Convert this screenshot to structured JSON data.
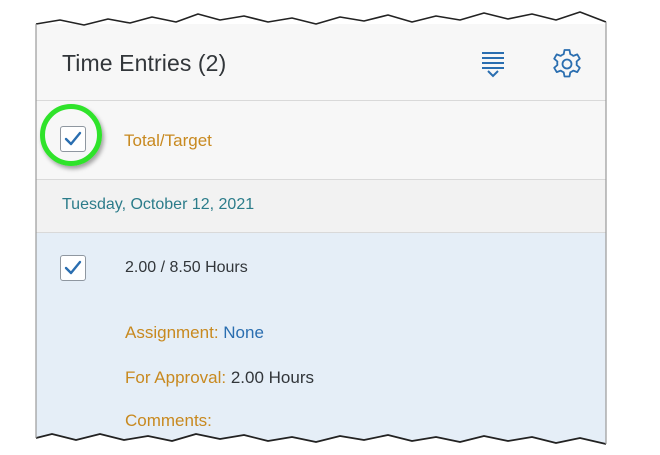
{
  "header": {
    "title": "Time Entries (2)"
  },
  "icons": {
    "sort": "sort-icon",
    "settings": "gear-icon",
    "checkmark": "checkmark-icon"
  },
  "total_row": {
    "label": "Total/Target",
    "checked": true
  },
  "date_group": {
    "label": "Tuesday, October 12, 2021"
  },
  "entry": {
    "checked": true,
    "hours": "2.00 / 8.50 Hours",
    "assignment_label": "Assignment:",
    "assignment_value": "None",
    "approval_label": "For Approval:",
    "approval_value": "2.00 Hours",
    "comments_label": "Comments:"
  },
  "colors": {
    "accent_label": "#c8891f",
    "link": "#2a6eb0",
    "date_text": "#2b7c8a",
    "selected_bg": "#e5eef7",
    "highlight_ring": "#2fe32a",
    "check": "#2a6eb0"
  }
}
